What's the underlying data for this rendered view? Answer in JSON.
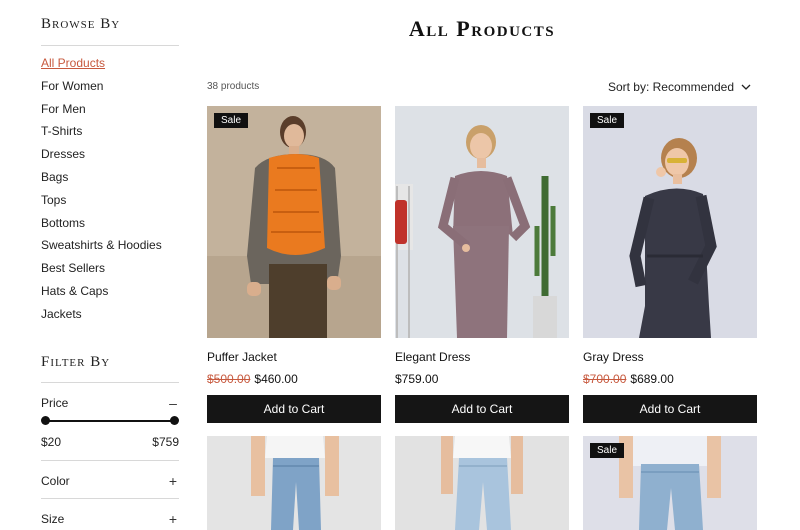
{
  "sidebar": {
    "browse_heading": "Browse By",
    "categories": [
      {
        "label": "All Products",
        "active": true
      },
      {
        "label": "For Women"
      },
      {
        "label": "For Men"
      },
      {
        "label": "T-Shirts"
      },
      {
        "label": "Dresses"
      },
      {
        "label": "Bags"
      },
      {
        "label": "Tops"
      },
      {
        "label": "Bottoms"
      },
      {
        "label": "Sweatshirts & Hoodies"
      },
      {
        "label": "Best Sellers"
      },
      {
        "label": "Hats & Caps"
      },
      {
        "label": "Jackets"
      }
    ],
    "filter_heading": "Filter By",
    "price": {
      "label": "Price",
      "toggle": "–",
      "min": "$20",
      "max": "$759"
    },
    "color": {
      "label": "Color",
      "toggle": "+"
    },
    "size": {
      "label": "Size",
      "toggle": "+"
    }
  },
  "main": {
    "title": "All Products",
    "count": "38 products",
    "sort_label": "Sort by: Recommended",
    "sale_label": "Sale",
    "add_label": "Add to Cart",
    "products": [
      {
        "name": "Puffer Jacket",
        "old_price": "$500.00",
        "price": "$460.00",
        "sale": true
      },
      {
        "name": "Elegant Dress",
        "old_price": "",
        "price": "$759.00",
        "sale": false
      },
      {
        "name": "Gray Dress",
        "old_price": "$700.00",
        "price": "$689.00",
        "sale": true
      },
      {
        "name": "",
        "old_price": "",
        "price": "",
        "sale": false
      },
      {
        "name": "",
        "old_price": "",
        "price": "",
        "sale": false
      },
      {
        "name": "",
        "old_price": "",
        "price": "",
        "sale": true
      }
    ]
  }
}
